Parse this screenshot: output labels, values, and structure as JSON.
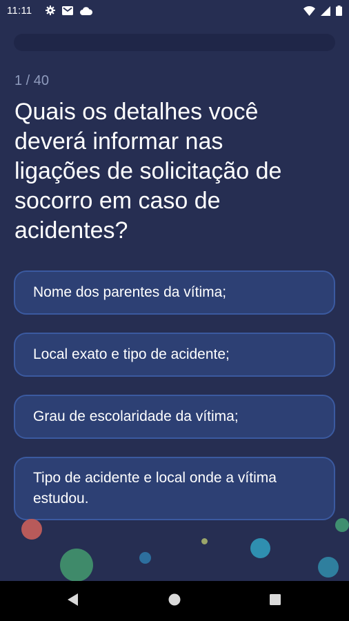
{
  "status_bar": {
    "time": "11:11",
    "left_icons": [
      "gear-icon",
      "mail-icon",
      "cloud-icon"
    ],
    "right_icons": [
      "wifi-icon",
      "signal-icon",
      "battery-icon"
    ]
  },
  "quiz": {
    "progress_fraction": 0.0,
    "counter": "1 / 40",
    "question": "Quais os detalhes você deverá informar nas ligações de solicitação de socorro em caso de acidentes?",
    "answers": [
      "Nome dos parentes da vítima;",
      "Local exato e tipo de acidente;",
      "Grau de escolaridade da vítima;",
      "Tipo de acidente e local onde a vítima estudou."
    ]
  },
  "colors": {
    "background": "#262e52",
    "answer_fill": "#2d4074",
    "answer_border": "#3b5aa0",
    "counter_text": "#8f9bbd"
  },
  "nav_bar": {
    "buttons": [
      "back-icon",
      "home-icon",
      "recents-icon"
    ]
  }
}
